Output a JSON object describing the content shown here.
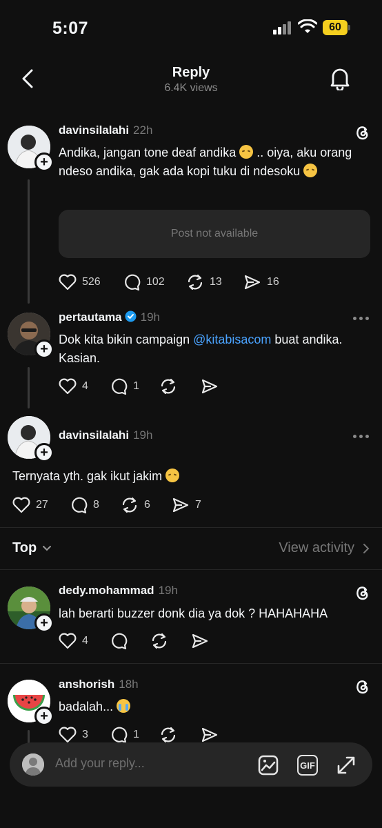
{
  "status_bar": {
    "time": "5:07",
    "battery": "60"
  },
  "header": {
    "title": "Reply",
    "subtitle": "6.4K views"
  },
  "posts": [
    {
      "username": "davinsilalahi",
      "time": "22h",
      "text_parts": [
        "Andika,  jangan tone deaf andika ",
        " .. oiya, aku orang ndeso andika, gak ada kopi tuku di ndesoku "
      ],
      "unavailable": "Post not available",
      "likes": "526",
      "comments": "102",
      "reposts": "13",
      "shares": "16"
    },
    {
      "username": "pertautama",
      "time": "19h",
      "text_before": "Dok kita bikin campaign ",
      "mention": "@kitabisacom",
      "text_after": " buat andika. Kasian.",
      "likes": "4",
      "comments": "1"
    },
    {
      "username": "davinsilalahi",
      "time": "19h",
      "text": "Ternyata yth. gak ikut jakim ",
      "likes": "27",
      "comments": "8",
      "reposts": "6",
      "shares": "7"
    }
  ],
  "sort": {
    "label": "Top",
    "view_activity": "View activity"
  },
  "replies": [
    {
      "username": "dedy.mohammad",
      "time": "19h",
      "text": "lah berarti buzzer donk dia ya dok ? HAHAHAHA",
      "likes": "4"
    },
    {
      "username": "anshorish",
      "time": "18h",
      "text": "badalah... ",
      "likes": "3",
      "comments": "1"
    }
  ],
  "reply_bar": {
    "placeholder": "Add your reply...",
    "gif_label": "GIF"
  },
  "icons": [
    "back-icon",
    "bell-icon",
    "threads-icon",
    "more-icon",
    "heart-icon",
    "comment-icon",
    "repost-icon",
    "share-icon",
    "image-icon",
    "gif-icon",
    "expand-icon"
  ],
  "colors": {
    "background": "#101010",
    "mention": "#4aa3ff",
    "verified": "#1d9bf0",
    "battery": "#f5cf1f"
  }
}
